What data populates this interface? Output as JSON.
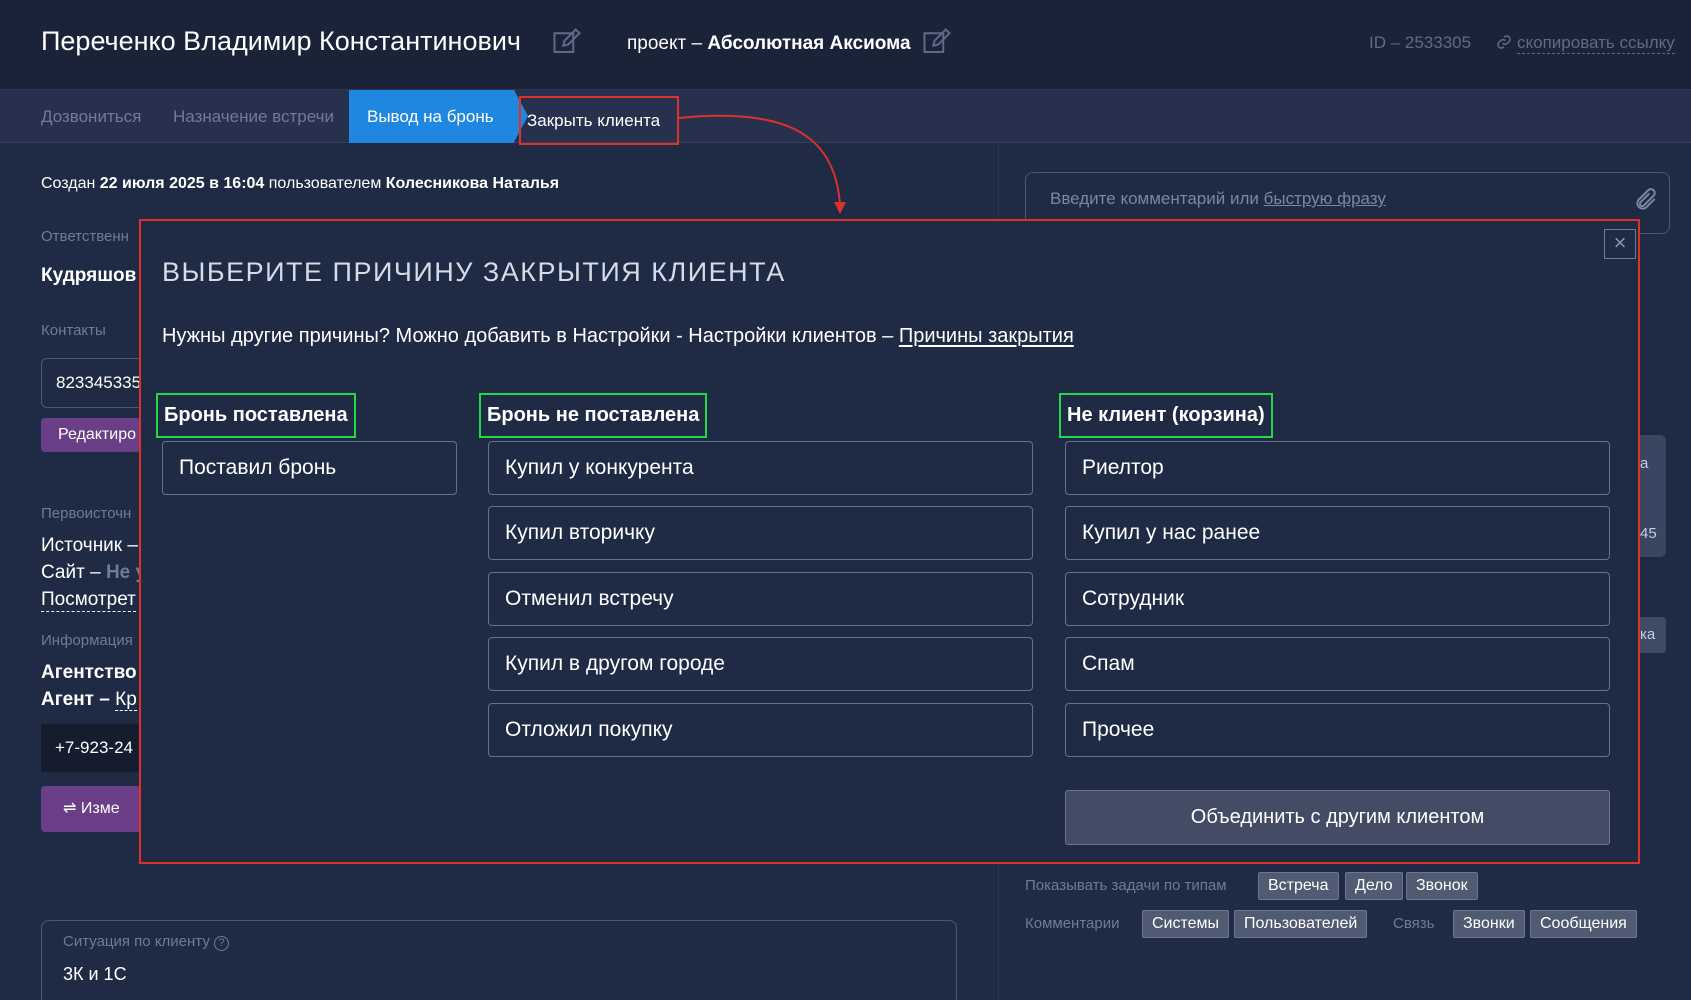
{
  "header": {
    "client_name": "Переченко Владимир Константинович",
    "project_prefix": "проект –",
    "project_name": "Абсолютная Аксиома",
    "id_label": "ID – 2533305",
    "copy_link": "скопировать ссылку"
  },
  "tabs": [
    {
      "label": "Дозвониться"
    },
    {
      "label": "Назначение встречи"
    },
    {
      "label": "Вывод на бронь"
    },
    {
      "label": "Закрыть клиента"
    }
  ],
  "info": {
    "created_prefix": "Создан",
    "created_date": "22 июля 2025 в 16:04",
    "created_mid": "пользователем",
    "created_user": "Колесникова Наталья",
    "responsible_label": "Ответственн",
    "responsible_value": "Кудряшов",
    "contacts_label": "Контакты",
    "phone_value": "823345335",
    "edit_button": "Редактиро",
    "source_label": "Первоисточн",
    "source_line": "Источник –",
    "site_prefix": "Сайт –",
    "site_value": "Не у",
    "view_link": "Посмотрет",
    "information_label": "Информация",
    "agency_label": "Агентство",
    "agent_label": "Агент –",
    "agent_value": "Кр",
    "agent_phone": "+7-923-24",
    "change_button": "Изме",
    "situation_label": "Ситуация по клиенту",
    "situation_value": "3К и 1С"
  },
  "right": {
    "comment_placeholder": "Введите комментарий или",
    "comment_quick_phrase": "быструю фразу",
    "side_peek_1": "а",
    "side_peek_2": "45",
    "side_peek_3": "ка",
    "filters": {
      "tasks_label": "Показывать задачи по типам",
      "task_chips": [
        "Встреча",
        "Дело",
        "Звонок"
      ],
      "comments_label": "Комментарии",
      "comment_chips": [
        "Системы",
        "Пользователей"
      ],
      "link_label": "Связь",
      "link_chips": [
        "Звонки",
        "Сообщения"
      ]
    }
  },
  "modal": {
    "title": "ВЫБЕРИТЕ ПРИЧИНУ ЗАКРЫТИЯ КЛИЕНТА",
    "hint_text": "Нужны другие причины? Можно добавить в Настройки - Настройки клиентов –",
    "hint_link": "Причины закрытия",
    "groups": [
      {
        "title": "Бронь поставлена",
        "items": [
          "Поставил бронь"
        ]
      },
      {
        "title": "Бронь не поставлена",
        "items": [
          "Купил у конкурента",
          "Купил вторичку",
          "Отменил встречу",
          "Купил в другом городе",
          "Отложил покупку"
        ]
      },
      {
        "title": "Не клиент (корзина)",
        "items": [
          "Риелтор",
          "Купил у нас ранее",
          "Сотрудник",
          "Спам",
          "Прочее"
        ]
      }
    ],
    "merge_button": "Объединить с другим клиентом",
    "close_glyph": "×"
  },
  "colors": {
    "background": "#1f2a44",
    "active_tab": "#1f87e0",
    "highlight_red": "#e0302a",
    "highlight_green": "#22d84a",
    "purple_button": "#6b3f88"
  }
}
